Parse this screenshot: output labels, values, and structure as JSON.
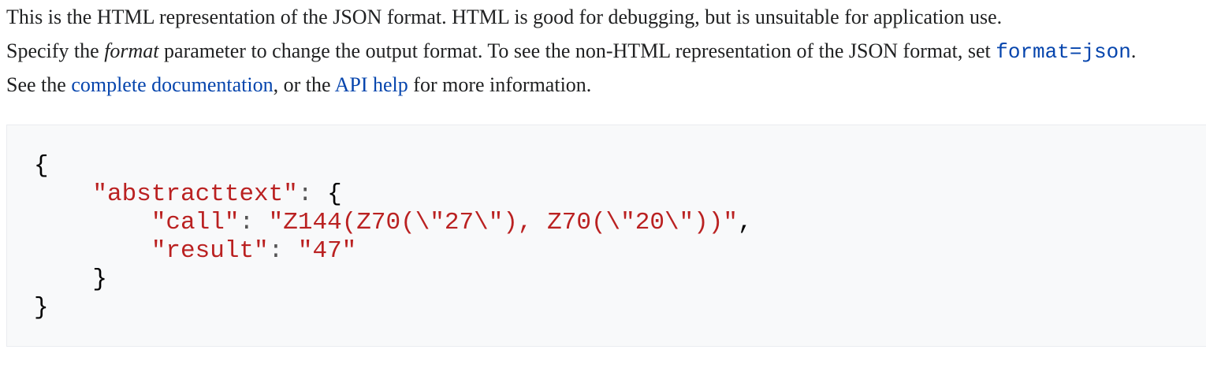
{
  "intro": {
    "line1": "This is the HTML representation of the JSON format. HTML is good for debugging, but is unsuitable for application use.",
    "line2_prefix": "Specify the ",
    "line2_param": "format",
    "line2_middle": " parameter to change the output format. To see the non-HTML representation of the JSON format, set ",
    "line2_code": "format=json",
    "line2_suffix": ".",
    "line3_prefix": "See the ",
    "line3_link1": "complete documentation",
    "line3_middle": ", or the ",
    "line3_link2": "API help",
    "line3_suffix": " for more information."
  },
  "json_output": {
    "open_brace": "{",
    "key_abstracttext": "\"abstracttext\"",
    "colon": ": ",
    "inner_open": "{",
    "key_call": "\"call\"",
    "val_call": "\"Z144(Z70(\\\"27\\\"), Z70(\\\"20\\\"))\"",
    "comma": ",",
    "key_result": "\"result\"",
    "val_result": "\"47\"",
    "inner_close": "}",
    "close_brace": "}"
  },
  "colors": {
    "text": "#202122",
    "link": "#0645ad",
    "string": "#ba2121",
    "code_background": "#f8f9fa",
    "code_border": "#eaecf0"
  }
}
